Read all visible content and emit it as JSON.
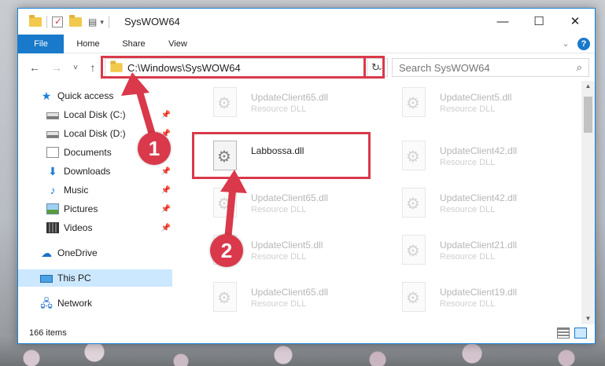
{
  "window": {
    "title": "SysWOW64",
    "controls": {
      "minimize": "—",
      "maximize": "☐",
      "close": "✕"
    }
  },
  "ribbon": {
    "tabs": [
      {
        "label": "File"
      },
      {
        "label": "Home"
      },
      {
        "label": "Share"
      },
      {
        "label": "View"
      }
    ],
    "expand_glyph": "⌄",
    "help_glyph": "?"
  },
  "nav": {
    "back": "←",
    "forward": "→",
    "recent": "˅",
    "up": "↑",
    "address": "C:\\Windows\\SysWOW64",
    "dropdown": "⌄",
    "refresh": "↻",
    "search_placeholder": "Search SysWOW64",
    "search_glyph": "⌕"
  },
  "sidebar": {
    "items": [
      {
        "label": "Quick access",
        "icon": "star-icon",
        "pinned": false
      },
      {
        "label": "Local Disk (C:)",
        "icon": "drive-icon",
        "pinned": true
      },
      {
        "label": "Local Disk (D:)",
        "icon": "drive-icon",
        "pinned": true
      },
      {
        "label": "Documents",
        "icon": "documents-icon",
        "pinned": true
      },
      {
        "label": "Downloads",
        "icon": "download-icon",
        "pinned": true
      },
      {
        "label": "Music",
        "icon": "music-icon",
        "pinned": true
      },
      {
        "label": "Pictures",
        "icon": "pictures-icon",
        "pinned": true
      },
      {
        "label": "Videos",
        "icon": "videos-icon",
        "pinned": true
      },
      {
        "label": "OneDrive",
        "icon": "cloud-icon",
        "pinned": false
      },
      {
        "label": "This PC",
        "icon": "pc-icon",
        "pinned": false
      },
      {
        "label": "Network",
        "icon": "network-icon",
        "pinned": false
      }
    ],
    "pin_glyph": "📌",
    "selected": "This PC"
  },
  "files": [
    {
      "name": "UpdateClient65.dll",
      "type": "Resource DLL",
      "active": false
    },
    {
      "name": "UpdateClient5.dll",
      "type": "Resource DLL",
      "active": false
    },
    {
      "name": "Labbossa.dll",
      "type": "",
      "active": true
    },
    {
      "name": "UpdateClient42.dll",
      "type": "Resource DLL",
      "active": false
    },
    {
      "name": "UpdateClient65.dll",
      "type": "Resource DLL",
      "active": false
    },
    {
      "name": "UpdateClient42.dll",
      "type": "Resource DLL",
      "active": false
    },
    {
      "name": "UpdateClient5.dll",
      "type": "Resource DLL",
      "active": false
    },
    {
      "name": "UpdateClient21.dll",
      "type": "Resource DLL",
      "active": false
    },
    {
      "name": "UpdateClient65.dll",
      "type": "Resource DLL",
      "active": false
    },
    {
      "name": "UpdateClient19.dll",
      "type": "Resource DLL",
      "active": false
    }
  ],
  "statusbar": {
    "item_count": "166 items"
  },
  "annotations": [
    {
      "label": "1"
    },
    {
      "label": "2"
    }
  ],
  "colors": {
    "accent": "#1979ca",
    "highlight": "#d9394b",
    "selected_bg": "#cce8ff"
  }
}
